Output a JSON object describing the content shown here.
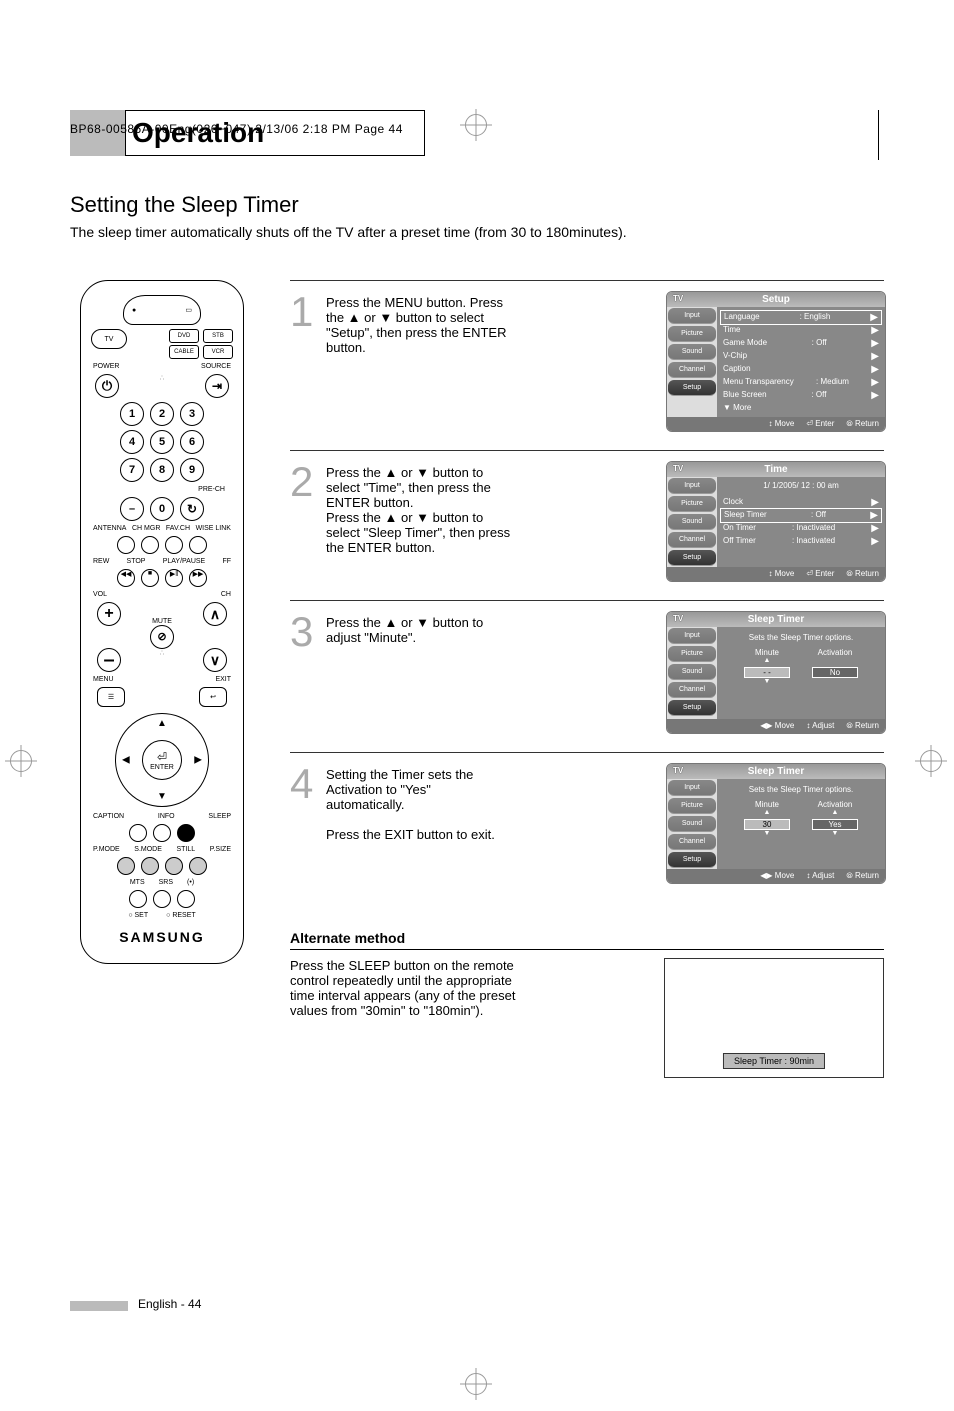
{
  "crop_header": "BP68-00586A-00Eng(026~047)  2/13/06  2:18 PM  Page 44",
  "section_title": "Operation",
  "subsection_title": "Setting the Sleep Timer",
  "subsection_desc": "The sleep timer automatically shuts off the TV after a preset time (from 30 to 180minutes).",
  "remote": {
    "device_buttons": [
      "DVD",
      "STB",
      "CABLE",
      "VCR"
    ],
    "tv_label": "TV",
    "power": "POWER",
    "source": "SOURCE",
    "numbers": [
      "1",
      "2",
      "3",
      "4",
      "5",
      "6",
      "7",
      "8",
      "9",
      "–",
      "0"
    ],
    "pre_ch": "PRE-CH",
    "row_labels_a": [
      "ANTENNA",
      "CH MGR",
      "FAV.CH",
      "WISE LINK"
    ],
    "transport": [
      "REW",
      "STOP",
      "PLAY/PAUSE",
      "FF"
    ],
    "transport_icons": [
      "◀◀",
      "■",
      "▶ǁ",
      "▶▶"
    ],
    "vol": "VOL",
    "ch": "CH",
    "mute": "MUTE",
    "menu": "MENU",
    "exit": "EXIT",
    "enter": "ENTER",
    "caption": "CAPTION",
    "info": "INFO",
    "sleep": "SLEEP",
    "row_labels_b": [
      "P.MODE",
      "S.MODE",
      "STILL",
      "P.SIZE"
    ],
    "row_labels_c": [
      "MTS",
      "SRS",
      "(•)"
    ],
    "set": "SET",
    "reset": "RESET",
    "brand": "SAMSUNG"
  },
  "steps": [
    {
      "num": "1",
      "text": "Press the MENU button. Press the ▲ or ▼ button to select \"Setup\", then press the ENTER button.",
      "osd": {
        "title": "Setup",
        "tv": "TV",
        "left": [
          "Input",
          "Picture",
          "Sound",
          "Channel",
          "Setup"
        ],
        "left_sel": 4,
        "right": [
          {
            "label": "Language",
            "value": ": English",
            "boxed": true
          },
          {
            "label": "Time",
            "value": ""
          },
          {
            "label": "Game Mode",
            "value": ": Off"
          },
          {
            "label": "V-Chip",
            "value": ""
          },
          {
            "label": "Caption",
            "value": ""
          },
          {
            "label": "Menu Transparency",
            "value": ": Medium"
          },
          {
            "label": "Blue Screen",
            "value": ": Off"
          },
          {
            "label": "▼ More",
            "value": "",
            "noarrow": true
          }
        ],
        "footer": [
          "↕ Move",
          "⏎ Enter",
          "⦾ Return"
        ]
      }
    },
    {
      "num": "2",
      "text": "Press the ▲ or ▼ button to select \"Time\", then press the ENTER button.\nPress the ▲ or ▼ button to select \"Sleep Timer\", then press the ENTER button.",
      "osd": {
        "title": "Time",
        "tv": "TV",
        "left": [
          "Input",
          "Picture",
          "Sound",
          "Channel",
          "Setup"
        ],
        "left_sel": 4,
        "heading": "1/  1/2005/ 12 : 00 am",
        "right": [
          {
            "label": "Clock",
            "value": ""
          },
          {
            "label": "Sleep Timer",
            "value": ": Off",
            "boxed": true
          },
          {
            "label": "On Timer",
            "value": ": Inactivated"
          },
          {
            "label": "Off Timer",
            "value": ": Inactivated"
          }
        ],
        "footer": [
          "↕ Move",
          "⏎ Enter",
          "⦾ Return"
        ]
      }
    },
    {
      "num": "3",
      "text": "Press the ▲ or ▼ button to adjust \"Minute\".",
      "osd": {
        "title": "Sleep Timer",
        "tv": "TV",
        "left": [
          "Input",
          "Picture",
          "Sound",
          "Channel",
          "Setup"
        ],
        "left_sel": 4,
        "sub": "Sets the Sleep Timer options.",
        "minact": {
          "minute_label": "Minute",
          "activation_label": "Activation",
          "minute": "- -",
          "minute_sel": true,
          "activation": "No"
        },
        "footer": [
          "◀▶ Move",
          "↕ Adjust",
          "⦾ Return"
        ]
      }
    },
    {
      "num": "4",
      "text": "Setting the Timer sets the Activation to \"Yes\" automatically.\n\nPress the EXIT button to exit.",
      "osd": {
        "title": "Sleep Timer",
        "tv": "TV",
        "left": [
          "Input",
          "Picture",
          "Sound",
          "Channel",
          "Setup"
        ],
        "left_sel": 4,
        "sub": "Sets the Sleep Timer options.",
        "minact": {
          "minute_label": "Minute",
          "activation_label": "Activation",
          "minute": "30",
          "minute_sel": true,
          "activation": "Yes",
          "activation_sel": true
        },
        "footer": [
          "◀▶ Move",
          "↕ Adjust",
          "⦾ Return"
        ]
      }
    }
  ],
  "alternate": {
    "title": "Alternate method",
    "text": "Press the SLEEP button on the remote control repeatedly until the appropriate time interval appears (any of the preset values from \"30min\" to \"180min\").",
    "label": "Sleep Timer : 90min"
  },
  "footer": "English - 44"
}
